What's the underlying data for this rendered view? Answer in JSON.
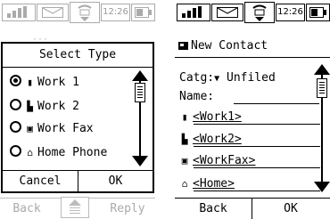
{
  "status": {
    "time": "12:26"
  },
  "left": {
    "dialog": {
      "title": "Select Type",
      "options": [
        {
          "label": "Work 1",
          "icon": "phone-icon",
          "selected": true
        },
        {
          "label": "Work 2",
          "icon": "building-icon",
          "selected": false
        },
        {
          "label": "Work Fax",
          "icon": "fax-icon",
          "selected": false
        },
        {
          "label": "Home Phone",
          "icon": "home-icon",
          "selected": false
        }
      ],
      "cancel_label": "Cancel",
      "ok_label": "OK"
    },
    "background": {
      "back_label": "Back",
      "reply_label": "Reply"
    }
  },
  "right": {
    "title": "New Contact",
    "category": {
      "label": "Catg:",
      "value": "Unfiled"
    },
    "name": {
      "label": "Name:"
    },
    "numbers": [
      {
        "label": "<Work1>",
        "icon": "phone-icon"
      },
      {
        "label": "<Work2>",
        "icon": "building-icon"
      },
      {
        "label": "<WorkFax>",
        "icon": "fax-icon"
      },
      {
        "label": "<Home>",
        "icon": "home-icon"
      }
    ],
    "back_label": "Back",
    "ok_label": "OK"
  }
}
